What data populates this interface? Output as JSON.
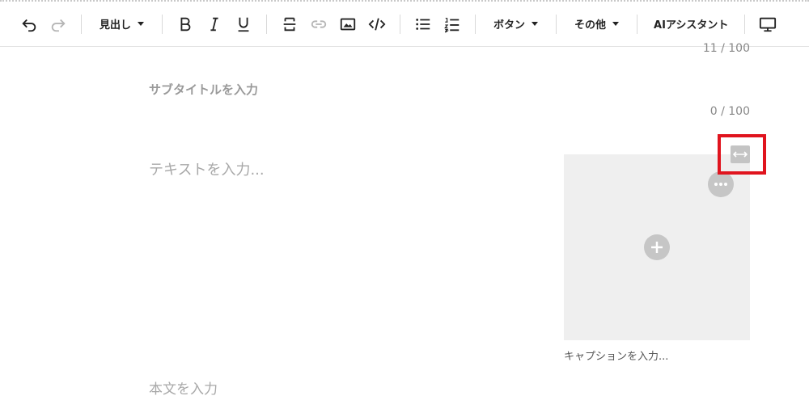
{
  "toolbar": {
    "heading_label": "見出し",
    "button_label": "ボタン",
    "other_label": "その他",
    "ai_label": "AIアシスタント",
    "icons": [
      "undo-icon",
      "redo-icon",
      "bold-icon",
      "italic-icon",
      "underline-icon",
      "strikethrough-icon",
      "link-icon",
      "image-icon",
      "code-icon",
      "bullet-list-icon",
      "numbered-list-icon",
      "preview-monitor-icon"
    ]
  },
  "editor": {
    "title_counter": "11 / 100",
    "subtitle_placeholder": "サブタイトルを入力",
    "subtitle_counter": "0 / 100",
    "text_placeholder": "テキストを入力...",
    "image_caption_placeholder": "キャプションを入力...",
    "body_placeholder": "本文を入力"
  },
  "colors": {
    "highlight": "#e0141e",
    "placeholder": "#a8a8a8",
    "image_bg": "#efefef"
  }
}
